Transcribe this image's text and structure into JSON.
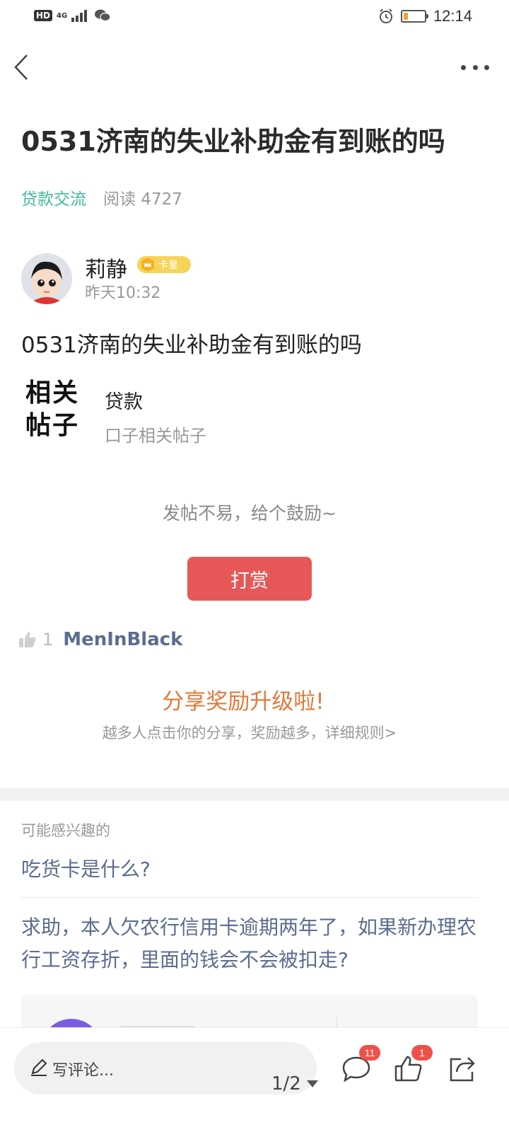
{
  "status_bar": {
    "network": "HD",
    "signal": "4G",
    "time": "12:14",
    "battery_level": 0.2,
    "battery_color": "#f0a030"
  },
  "post": {
    "title": "0531济南的失业补助金有到账的吗",
    "category": "贷款交流",
    "reads": "阅读 4727",
    "author": {
      "name": "莉静",
      "badge": "卡皇",
      "time": "昨天10:32"
    },
    "body": "0531济南的失业补助金有到账的吗",
    "related": {
      "mark": "相关帖子",
      "tag": "贷款",
      "link": "口子相关帖子"
    }
  },
  "reward": {
    "encourage": "发帖不易，给个鼓励~",
    "button": "打赏"
  },
  "likes": {
    "count": "1",
    "users": "MenInBlack"
  },
  "share": {
    "title": "分享奖励升级啦!",
    "subtitle": "越多人点击你的分享，奖励越多，详细规则>"
  },
  "interest": {
    "heading": "可能感兴趣的",
    "items": [
      "吃货卡是什么?",
      "求助，本人欠农行信用卡逾期两年了，如果新办理农行工资存折，里面的钱会不会被扣走?"
    ]
  },
  "bottom_bar": {
    "comment_placeholder": "写评论...",
    "page": "1/2",
    "comment_badge": "11",
    "like_badge": "1"
  },
  "colors": {
    "accent_green": "#3fb89a",
    "reward_red": "#e85757",
    "share_orange": "#e07a3a",
    "link_blue": "#5b6d8f",
    "badge_red": "#f0504a"
  }
}
